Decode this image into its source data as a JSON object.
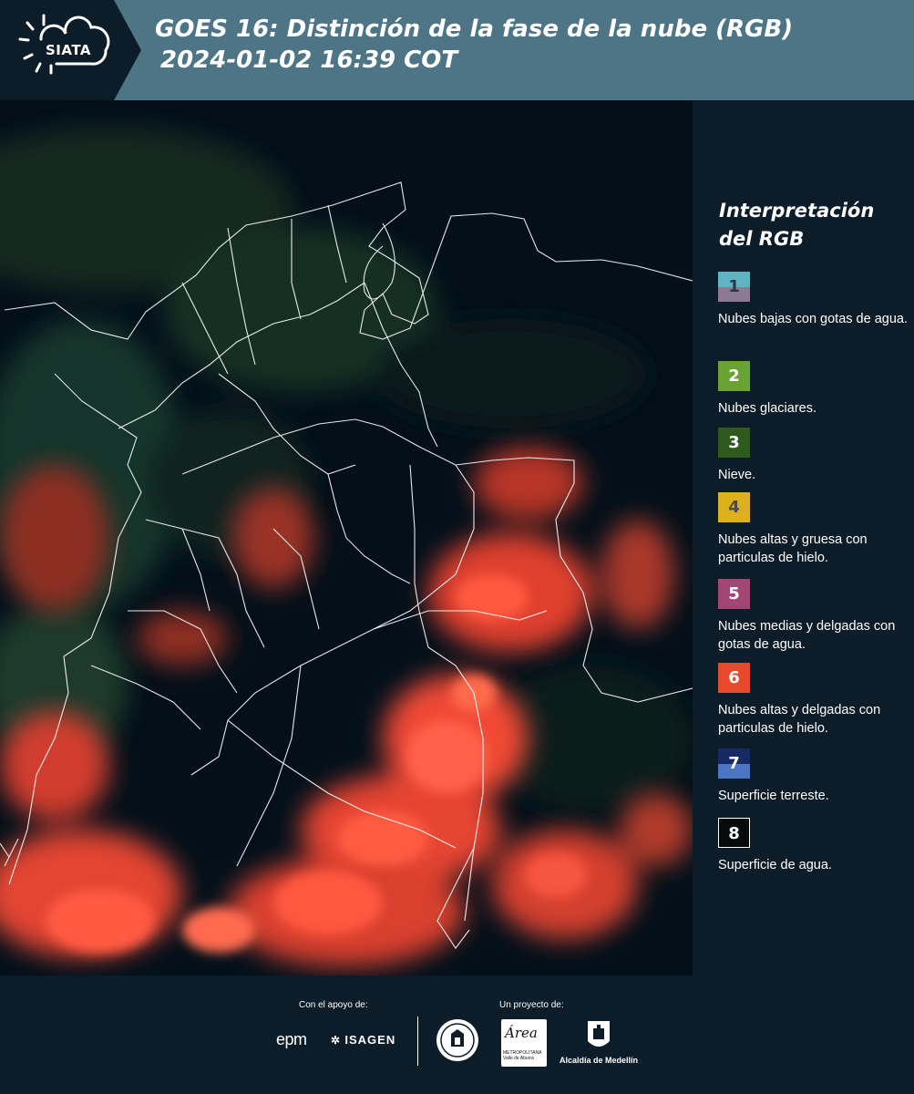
{
  "header": {
    "logo_text": "SIATA",
    "title_line1": "GOES 16: Distinción de la fase de la nube (RGB)",
    "title_line2": "2024-01-02 16:39 COT"
  },
  "legend": {
    "title": "Interpretación del RGB",
    "items": [
      {
        "num": "1",
        "top": "#5fb4c2",
        "bottom": "#8c7a92",
        "label": "Nubes bajas con gotas de agua."
      },
      {
        "num": "2",
        "color": "#6aa334",
        "label": "Nubes glaciares."
      },
      {
        "num": "3",
        "color": "#2e5b1d",
        "label": "Nieve."
      },
      {
        "num": "4",
        "color": "#ddb11e",
        "label": "Nubes altas y gruesa con particulas de hielo."
      },
      {
        "num": "5",
        "color": "#a24676",
        "label": "Nubes medias y delgadas con gotas de agua."
      },
      {
        "num": "6",
        "color": "#e9492b",
        "label": "Nubes altas y delgadas con particulas de hielo."
      },
      {
        "num": "7",
        "top": "#182a63",
        "bottom": "#4b77c2",
        "label": "Superficie terreste."
      },
      {
        "num": "8",
        "color": "#050b0a",
        "label": "Superficie de agua."
      }
    ]
  },
  "footer": {
    "support_label": "Con el apoyo de:",
    "project_label": "Un proyecto de:",
    "epm": "epm",
    "isagen": "ISAGEN",
    "area_text": "Área",
    "area_sub": "METROPOLITANA Valle de Aburrá",
    "alcaldia": "Alcaldía de Medellín"
  }
}
